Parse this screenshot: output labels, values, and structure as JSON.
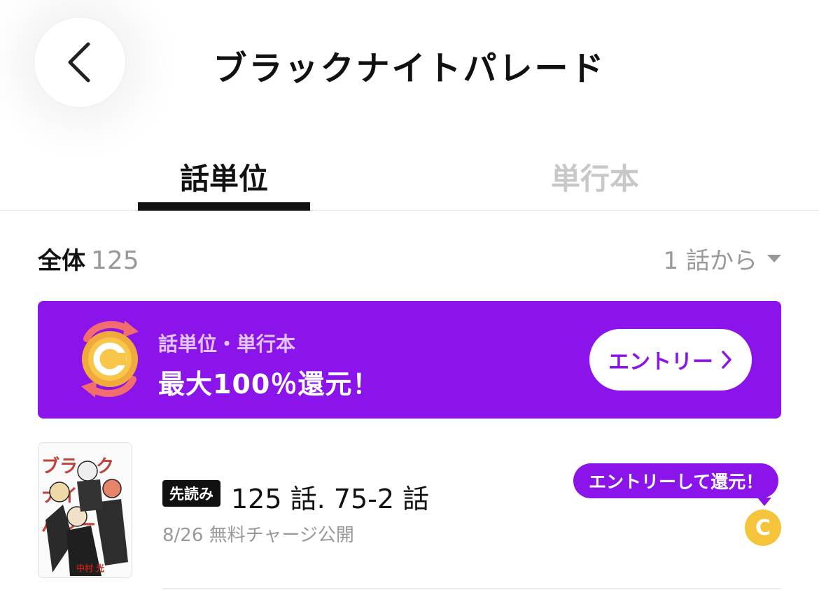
{
  "header": {
    "title": "ブラックナイトパレード",
    "back_icon": "chevron-left-icon"
  },
  "tabs": [
    {
      "label": "話単位",
      "active": true
    },
    {
      "label": "単行本",
      "active": false
    }
  ],
  "summary": {
    "label": "全体",
    "count": "125",
    "sort_label": "1 話から",
    "sort_icon": "caret-down-icon"
  },
  "banner": {
    "subtitle": "話単位・単行本",
    "headline": "最大100％還元！",
    "button_label": "エントリー",
    "button_icon": "chevron-right-icon",
    "background": "#8a14ea",
    "coin_letter": "C"
  },
  "episodes": [
    {
      "badge": "先読み",
      "title": "125 話. 75-2 話",
      "meta": "8/26 無料チャージ公開",
      "tooltip": "エントリーして還元！",
      "coin_letter": "C",
      "thumbnail_author": "中村 光"
    }
  ],
  "colors": {
    "accent": "#8a14ea",
    "coin": "#f5c43a",
    "muted_text": "#999999"
  }
}
